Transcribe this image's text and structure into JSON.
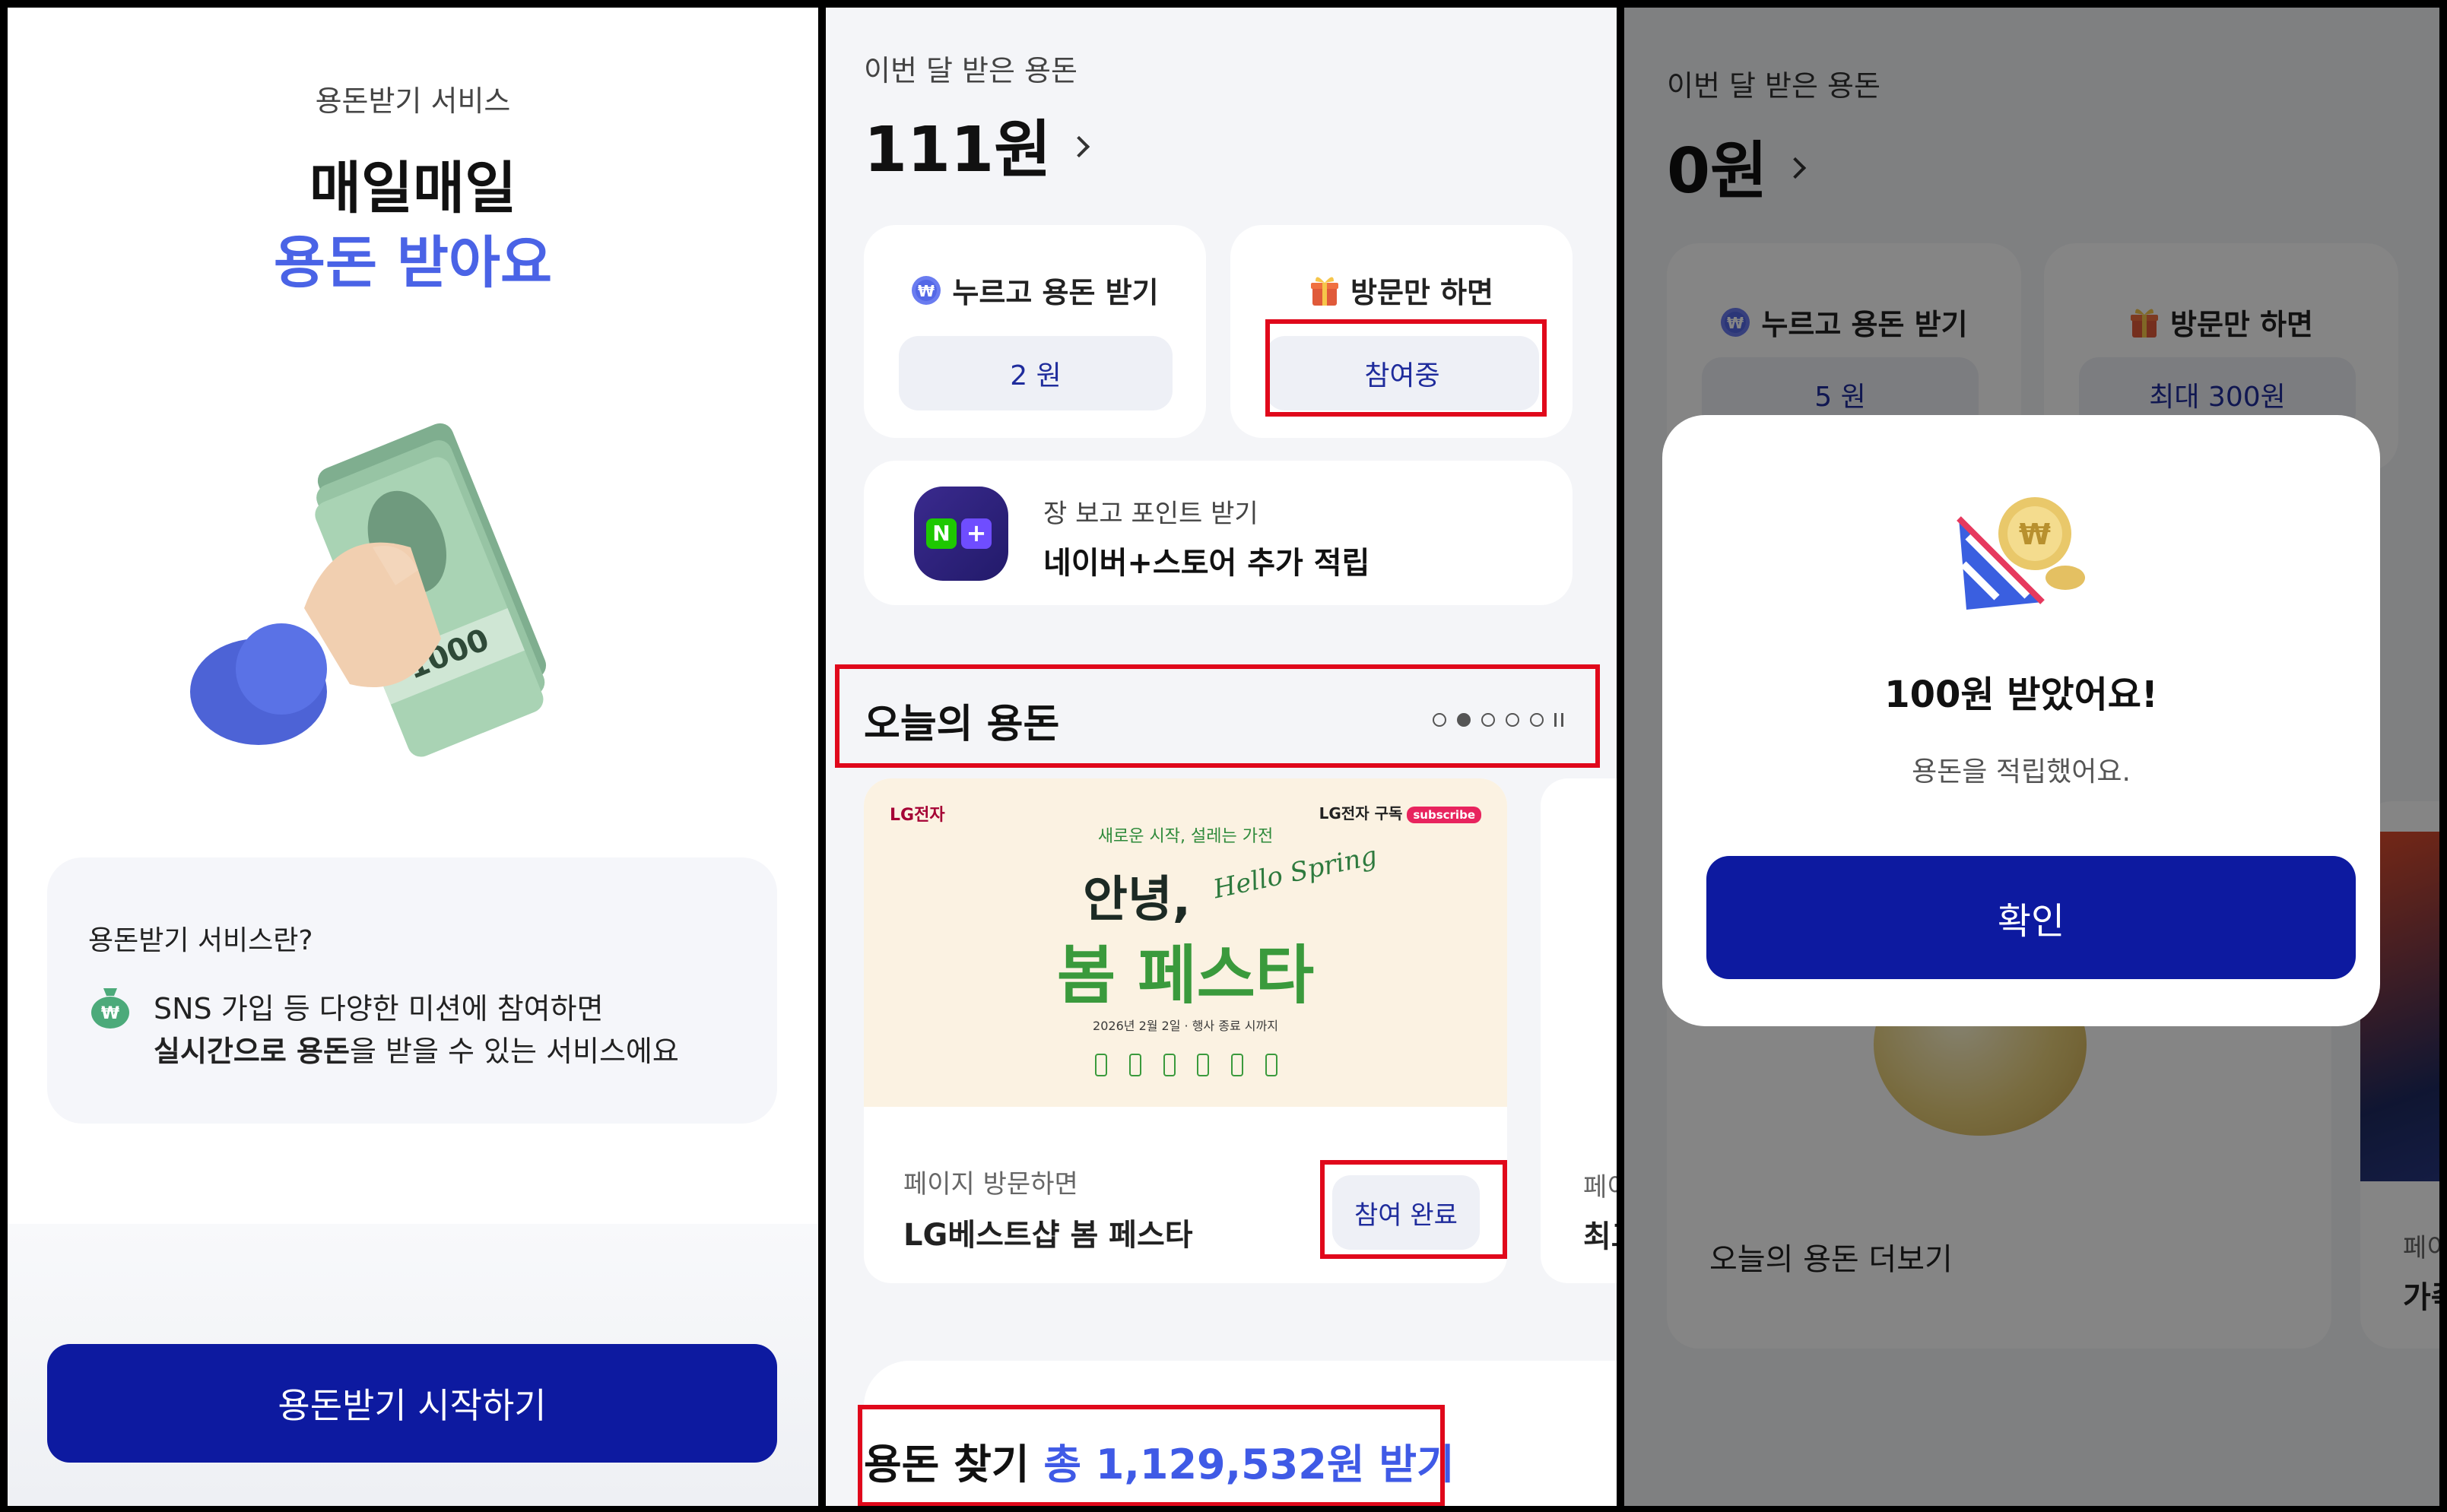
{
  "panel1": {
    "service_label": "용돈받기 서비스",
    "title_line1": "매일매일",
    "title_line2": "용돈 받아요",
    "info_title": "용돈받기 서비스란?",
    "info_line1": "SNS 가입 등 다양한 미션에 참여하면",
    "info_line2_bold": "실시간으로 용돈",
    "info_line2_rest": "을 받을 수 있는 서비스에요",
    "start_button": "용돈받기 시작하기",
    "illustration_icon": "hand-holding-cash-icon",
    "banknote_label": "1000"
  },
  "panel2": {
    "month_label": "이번 달 받은 용돈",
    "month_amount": "111원",
    "press_card": {
      "title": "누르고 용돈 받기",
      "value": "2 원",
      "icon": "won-coin-icon"
    },
    "visit_card": {
      "title": "방문만 하면",
      "value": "참여중",
      "icon": "gift-icon"
    },
    "naver_card": {
      "subtitle": "장 보고 포인트 받기",
      "title": "네이버+스토어 추가 적립",
      "logo_n": "N",
      "logo_plus": "+"
    },
    "today_title": "오늘의 용돈",
    "carousel": {
      "total_dots": 5,
      "active_index": 1
    },
    "promo": {
      "brand": "LG전자",
      "subscribe_brand": "LG전자 구독",
      "subscribe_tag": "subscribe",
      "tagline": "새로운 시작, 설레는 가전",
      "hello": "안녕,",
      "script": "Hello Spring",
      "festival": "봄 페스타",
      "date_note": "2026년 2월 2일 · 행사 종료 시까지",
      "visit_label": "페이지 방문하면",
      "name": "LG베스트샵 봄 페스타",
      "status_button": "참여 완료"
    },
    "peek": {
      "line1": "페이",
      "line2": "최고"
    },
    "find_title": "용돈 찾기",
    "find_total": "총 1,129,532원 받기"
  },
  "panel3": {
    "month_label": "이번 달 받은 용돈",
    "month_amount": "0원",
    "press_card": {
      "title": "누르고 용돈 받기",
      "value": "5 원",
      "icon": "won-coin-icon"
    },
    "visit_card": {
      "title": "방문만 하면",
      "value": "최대 300원",
      "icon": "gift-icon"
    },
    "more_label": "오늘의 용돈 더보기",
    "peek": {
      "line1": "페이",
      "line2": "가족"
    },
    "modal": {
      "title": "100원 받았어요!",
      "message": "용돈을 적립했어요.",
      "confirm": "확인",
      "icon": "party-popper-coin-icon"
    }
  },
  "colors": {
    "primary_navy": "#0d1aa0",
    "accent_blue": "#4a63e6",
    "highlight_red": "#e0081b"
  }
}
